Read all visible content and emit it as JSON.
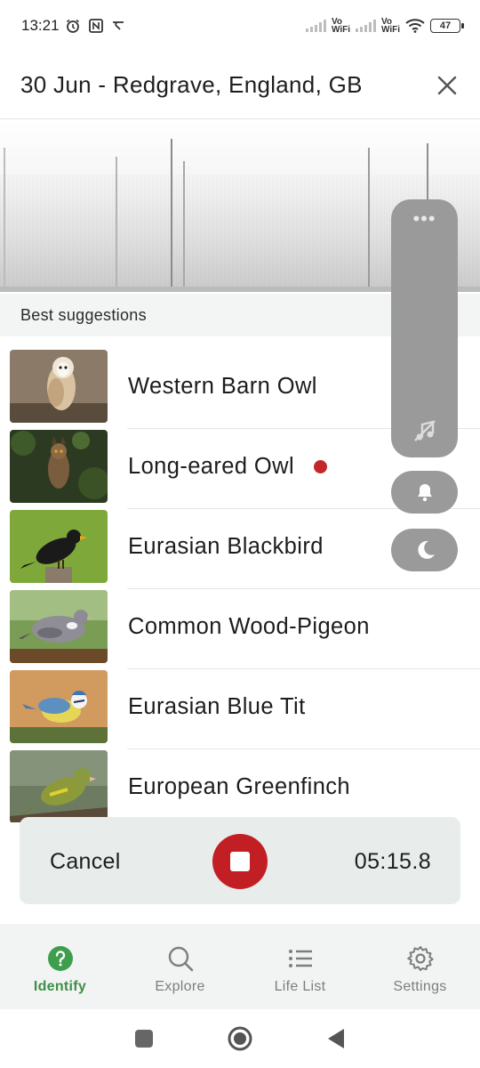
{
  "status_bar": {
    "time": "13:21",
    "icons": [
      "alarm-icon",
      "nfc-icon",
      "notification-icon"
    ],
    "network": [
      "Vo",
      "WiFi",
      "Vo",
      "WiFi"
    ],
    "battery": "47"
  },
  "header": {
    "title": "30 Jun - Redgrave, England, GB",
    "close_icon": "close-icon"
  },
  "suggestions": {
    "heading": "Best suggestions",
    "birds": [
      {
        "name": "Western Barn Owl",
        "new": false
      },
      {
        "name": "Long-eared Owl",
        "new": true
      },
      {
        "name": "Eurasian Blackbird",
        "new": false
      },
      {
        "name": "Common Wood-Pigeon",
        "new": false
      },
      {
        "name": "Eurasian Blue Tit",
        "new": false
      },
      {
        "name": "European Greenfinch",
        "new": false
      }
    ]
  },
  "side_panel": {
    "icons": [
      "more-icon",
      "music-off-icon",
      "bell-icon",
      "moon-icon"
    ]
  },
  "recording": {
    "cancel_label": "Cancel",
    "timer": "05:15.8",
    "stop_icon": "stop-icon"
  },
  "bottom_nav": [
    {
      "label": "Identify",
      "icon": "help-circle-icon",
      "active": true
    },
    {
      "label": "Explore",
      "icon": "search-icon",
      "active": false
    },
    {
      "label": "Life List",
      "icon": "list-icon",
      "active": false
    },
    {
      "label": "Settings",
      "icon": "gear-icon",
      "active": false
    }
  ],
  "system_nav": [
    "recents-icon",
    "home-icon",
    "back-icon"
  ],
  "colors": {
    "accent_green": "#3e8e4a",
    "record_red": "#c21f25",
    "new_dot": "#c2282a",
    "panel_gray": "#9a9a9a"
  }
}
